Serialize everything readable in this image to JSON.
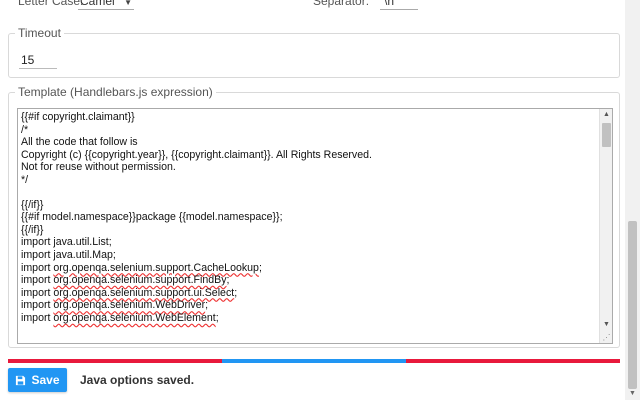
{
  "options": {
    "letter_case_label": "Letter Case:",
    "letter_case_value": "Camel",
    "separator_label": "Separator:",
    "separator_value": "\\n"
  },
  "timeout": {
    "legend": "Timeout",
    "value": "15"
  },
  "template": {
    "legend": "Template (Handlebars.js expression)",
    "lines": [
      "{{#if copyright.claimant}}",
      "/*",
      "All the code that follow is",
      "Copyright (c) {{copyright.year}}, {{copyright.claimant}}. All Rights Reserved.",
      "Not for reuse without permission.",
      "*/",
      "",
      "{{/if}}",
      "{{#if model.namespace}}package {{model.namespace}};",
      "{{/if}}",
      "import java.util.List;",
      "import java.util.Map;",
      "import org.openqa.selenium.support.CacheLookup;",
      "import org.openqa.selenium.support.FindBy;",
      "import org.openqa.selenium.support.ui.Select;",
      "import org.openqa.selenium.WebDriver;",
      "import org.openqa.selenium.WebElement;"
    ]
  },
  "progress": {
    "segments": [
      {
        "color": "#e8193c",
        "fraction": 0.35
      },
      {
        "color": "#2196f3",
        "fraction": 0.3
      },
      {
        "color": "#e8193c",
        "fraction": 0.35
      }
    ]
  },
  "actions": {
    "save_label": "Save",
    "status_text": "Java options saved."
  },
  "icons": {
    "save": "floppy-disk-icon",
    "select_caret": "chevron-down-icon"
  },
  "colors": {
    "primary": "#2196f3",
    "accent_red": "#e8193c"
  }
}
